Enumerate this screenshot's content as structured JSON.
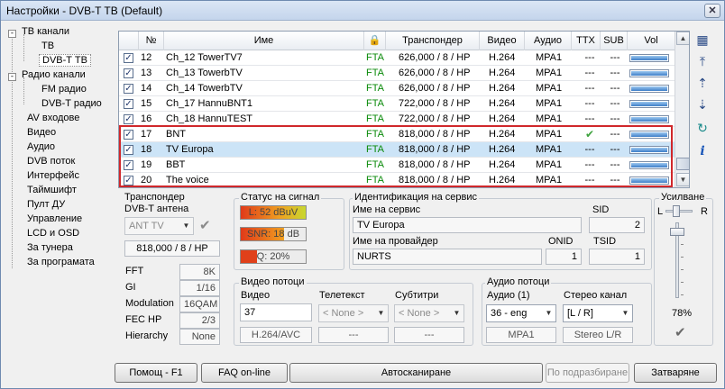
{
  "window": {
    "title": "Настройки - DVB-T TB (Default)",
    "close_label": "✕"
  },
  "tree": [
    {
      "label": "ТВ канали",
      "level": 0,
      "expander": "-"
    },
    {
      "label": "ТВ",
      "level": 1,
      "expander": ""
    },
    {
      "label": "DVB-T ТВ",
      "level": 1,
      "expander": "",
      "selected": true
    },
    {
      "label": "Радио канали",
      "level": 0,
      "expander": "-"
    },
    {
      "label": "FM радио",
      "level": 1,
      "expander": ""
    },
    {
      "label": "DVB-T радио",
      "level": 1,
      "expander": ""
    },
    {
      "label": "AV входове",
      "level": 0,
      "expander": ""
    },
    {
      "label": "Видео",
      "level": 0,
      "expander": ""
    },
    {
      "label": "Аудио",
      "level": 0,
      "expander": ""
    },
    {
      "label": "DVB поток",
      "level": 0,
      "expander": ""
    },
    {
      "label": "Интерфейс",
      "level": 0,
      "expander": ""
    },
    {
      "label": "Таймшифт",
      "level": 0,
      "expander": ""
    },
    {
      "label": "Пулт ДУ",
      "level": 0,
      "expander": ""
    },
    {
      "label": "Управление",
      "level": 0,
      "expander": ""
    },
    {
      "label": "LCD и OSD",
      "level": 0,
      "expander": ""
    },
    {
      "label": "За тунера",
      "level": 0,
      "expander": ""
    },
    {
      "label": "За програмата",
      "level": 0,
      "expander": ""
    }
  ],
  "grid": {
    "headers": {
      "num": "№",
      "name": "Име",
      "lock": "🔒",
      "transponder": "Транспондер",
      "video": "Видео",
      "audio": "Аудио",
      "ttx": "TTX",
      "sub": "SUB",
      "vol": "Vol"
    },
    "rows": [
      {
        "num": "12",
        "name": "Ch_12 TowerTV7",
        "scr": "FTA",
        "tp": "626,000 / 8 / HP",
        "video": "H.264",
        "audio": "MPA1",
        "ttx": "---",
        "sub": "---",
        "checked": "✓"
      },
      {
        "num": "13",
        "name": "Ch_13 TowerbTV",
        "scr": "FTA",
        "tp": "626,000 / 8 / HP",
        "video": "H.264",
        "audio": "MPA1",
        "ttx": "---",
        "sub": "---",
        "checked": "✓"
      },
      {
        "num": "14",
        "name": "Ch_14 TowerbTV",
        "scr": "FTA",
        "tp": "626,000 / 8 / HP",
        "video": "H.264",
        "audio": "MPA1",
        "ttx": "---",
        "sub": "---",
        "checked": "✓"
      },
      {
        "num": "15",
        "name": "Ch_17 HannuBNT1",
        "scr": "FTA",
        "tp": "722,000 / 8 / HP",
        "video": "H.264",
        "audio": "MPA1",
        "ttx": "---",
        "sub": "---",
        "checked": "✓"
      },
      {
        "num": "16",
        "name": "Ch_18 HannuTEST",
        "scr": "FTA",
        "tp": "722,000 / 8 / HP",
        "video": "H.264",
        "audio": "MPA1",
        "ttx": "---",
        "sub": "---",
        "checked": "✓"
      },
      {
        "num": "17",
        "name": "BNT",
        "scr": "FTA",
        "tp": "818,000 / 8 / HP",
        "video": "H.264",
        "audio": "MPA1",
        "ttx": "✔",
        "sub": "---",
        "checked": "✓"
      },
      {
        "num": "18",
        "name": "TV Europa",
        "scr": "FTA",
        "tp": "818,000 / 8 / HP",
        "video": "H.264",
        "audio": "MPA1",
        "ttx": "---",
        "sub": "---",
        "checked": "✓",
        "selected": true
      },
      {
        "num": "19",
        "name": "BBT",
        "scr": "FTA",
        "tp": "818,000 / 8 / HP",
        "video": "H.264",
        "audio": "MPA1",
        "ttx": "---",
        "sub": "---",
        "checked": "✓"
      },
      {
        "num": "20",
        "name": "The voice",
        "scr": "FTA",
        "tp": "818,000 / 8 / HP",
        "video": "H.264",
        "audio": "MPA1",
        "ttx": "---",
        "sub": "---",
        "checked": "✓"
      }
    ]
  },
  "transponder": {
    "title": "Транспондер",
    "antenna_label": "DVB-T антена",
    "antenna_value": "ANT TV",
    "freq": "818,000 / 8 / HP",
    "fft_label": "FFT",
    "fft": "8K",
    "gi_label": "GI",
    "gi": "1/16",
    "mod_label": "Modulation",
    "mod": "16QAM",
    "fec_label": "FEC HP",
    "fec": "2/3",
    "hier_label": "Hierarchy",
    "hier": "None"
  },
  "signal": {
    "title": "Статус на сигнал",
    "level": "L: 52 dBuV",
    "snr": "SNR: 18 dB",
    "quality": "Q: 20%"
  },
  "service": {
    "title": "Идентификация на сервис",
    "name_label": "Име на сервис",
    "name": "TV Europa",
    "sid_label": "SID",
    "sid": "2",
    "provider_label": "Име на провайдер",
    "provider": "NURTS",
    "onid_label": "ONID",
    "onid": "1",
    "tsid_label": "TSID",
    "tsid": "1"
  },
  "video_streams": {
    "title": "Видео потоци",
    "video_label": "Видео",
    "video_pid": "37",
    "video_codec": "H.264/AVC",
    "ttx_label": "Телетекст",
    "ttx_value": "< None >",
    "ttx_info": "---",
    "sub_label": "Субтитри",
    "sub_value": "< None >",
    "sub_info": "---"
  },
  "audio_streams": {
    "title": "Аудио потоци",
    "audio_label": "Аудио (1)",
    "audio_value": "36 - eng",
    "audio_codec": "MPA1",
    "stereo_label": "Стерео канал",
    "stereo_value": "[L / R]",
    "stereo_info": "Stereo L/R"
  },
  "gain": {
    "title": "Усилване",
    "left": "L",
    "right": "R",
    "percent": "78%",
    "ok": "✔"
  },
  "buttons": {
    "help": "Помощ - F1",
    "faq": "FAQ on-line",
    "autoscan": "Автосканиране",
    "defaults": "По подразбиране",
    "close": "Затваряне"
  },
  "sidebar_icons": [
    "grid-icon",
    "move-top-icon",
    "move-up-icon",
    "move-down-icon",
    "refresh-icon",
    "info-icon"
  ]
}
